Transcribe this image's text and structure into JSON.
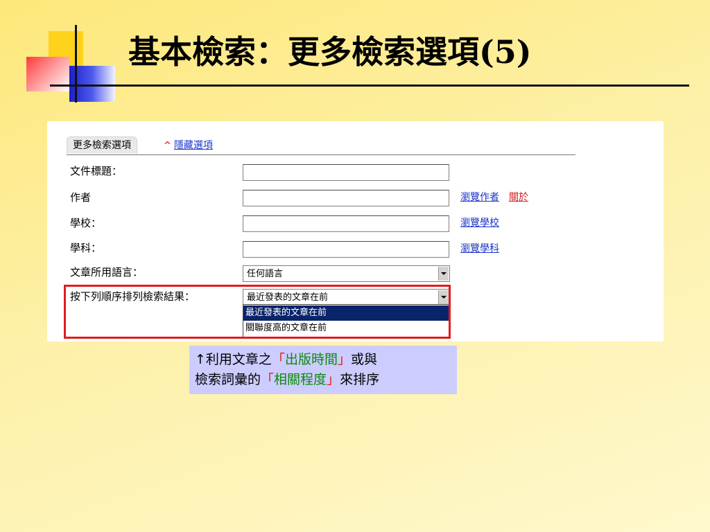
{
  "slide": {
    "title": "基本檢索：更多檢索選項(5)"
  },
  "panel": {
    "tab_label": "更多檢索選項",
    "hide_label": "隱藏選項",
    "fields": {
      "title_label": "文件標題：",
      "author_label": "作者",
      "school_label": "學校：",
      "subject_label": "學科：",
      "language_label": "文章所用語言：",
      "sort_label": "按下列順序排列檢索結果："
    },
    "links": {
      "browse_author": "瀏覽作者",
      "about": "關於",
      "browse_school": "瀏覽學校",
      "browse_subject": "瀏覽學科"
    },
    "language_select": {
      "value": "任何語言"
    },
    "sort_select": {
      "value": "最近發表的文章在前",
      "options": [
        "最近發表的文章在前",
        "關聯度高的文章在前"
      ]
    }
  },
  "caption": {
    "line1_prefix": "↑利用文章之",
    "line1_q_open": "「",
    "line1_highlight": "出版時間",
    "line1_q_close": "」",
    "line1_suffix": "或與",
    "line2_prefix": "檢索詞彙的",
    "line2_q_open": "「",
    "line2_highlight": "相關程度",
    "line2_q_close": "」",
    "line2_suffix": "來排序"
  },
  "colors": {
    "link": "#1a34c9",
    "highlight_border": "#e01c1c",
    "selected_option_bg": "#0a246a",
    "caption_bg": "#ccccff",
    "caption_green": "#0a8a0a"
  },
  "icons": [
    "caret-up-icon",
    "dropdown-arrow-icon"
  ]
}
